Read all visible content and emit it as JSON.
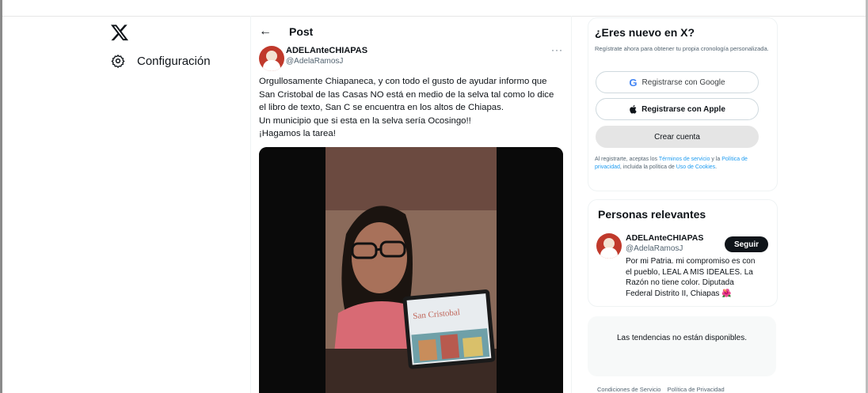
{
  "nav": {
    "logo": "X",
    "items": [
      {
        "label": "Configuración",
        "icon": "gear-icon"
      }
    ]
  },
  "post": {
    "header_title": "Post",
    "author_name": "ADELAnteCHIAPAS",
    "author_handle": "@AdelaRamosJ",
    "more_label": "···",
    "text_lines": [
      "Orgullosamente Chiapaneca, y con todo el gusto de ayudar informo que",
      "San Cristobal de las Casas NO está en medio de la selva tal como lo dice",
      "el libro de texto, San C se encuentra en los altos de Chiapas.",
      "Un municipio que si esta en la selva sería Ocosingo!!",
      "¡Hagamos la tarea!"
    ],
    "media_caption": "San Cristobal"
  },
  "signup": {
    "title": "¿Eres nuevo en X?",
    "subtitle": "Regístrate ahora para obtener tu propia cronología personalizada.",
    "google_label": "Registrarse con Google",
    "apple_label": "Registrarse con Apple",
    "create_label": "Crear cuenta",
    "legal_prefix": "Al registrarte, aceptas los ",
    "legal_terms": "Términos de servicio",
    "legal_mid1": " y la ",
    "legal_privacy": "Política de privacidad",
    "legal_mid2": ", incluida la política de ",
    "legal_cookies": "Uso de Cookies",
    "legal_end": "."
  },
  "relevant": {
    "title": "Personas relevantes",
    "name": "ADELAnteCHIAPAS",
    "handle": "@AdelaRamosJ",
    "follow_label": "Seguir",
    "bio_lines": [
      "Por mi Patria. mi compromiso es con",
      "el pueblo, LEAL A MIS IDEALES. La",
      "Razón no tiene color. Diputada",
      "Federal Distrito II, Chiapas 🌺"
    ]
  },
  "trends": {
    "message": "Las tendencias no están disponibles."
  },
  "footer": {
    "links": [
      "Condiciones de Servicio",
      "Política de Privacidad"
    ]
  },
  "colors": {
    "accent": "#1d9bf0",
    "text": "#0f1419",
    "muted": "#536471",
    "follow_bg": "#0f1419"
  }
}
